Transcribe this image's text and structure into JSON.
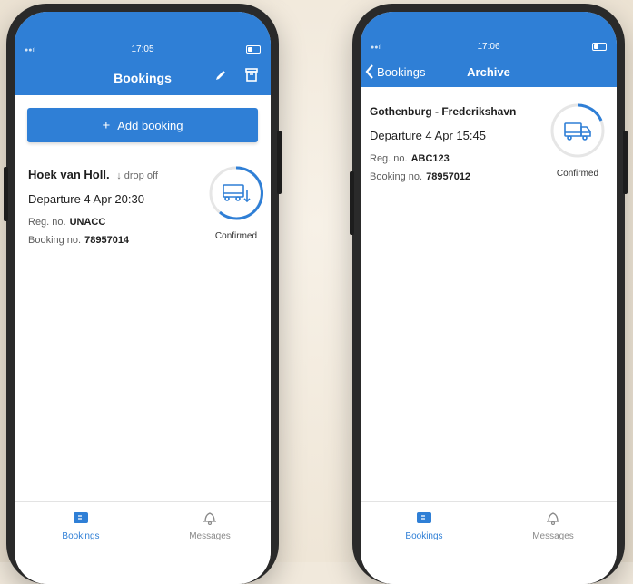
{
  "left": {
    "time": "17:05",
    "title": "Bookings",
    "add_button_label": "Add booking",
    "booking": {
      "route": "Hoek van Holl.",
      "tag": "drop off",
      "departure": "Departure 4 Apr 20:30",
      "reg_label": "Reg. no.",
      "reg_value": "UNACC",
      "booking_label": "Booking no.",
      "booking_value": "78957014",
      "status": "Confirmed",
      "icon": "truck-drop-off-icon"
    },
    "tabs": [
      {
        "label": "Bookings",
        "icon": "ticket-icon",
        "active": true
      },
      {
        "label": "Messages",
        "icon": "bell-icon",
        "active": false
      }
    ]
  },
  "right": {
    "time": "17:06",
    "back_label": "Bookings",
    "title": "Archive",
    "booking": {
      "route": "Gothenburg - Frederikshavn",
      "departure": "Departure 4 Apr 15:45",
      "reg_label": "Reg. no.",
      "reg_value": "ABC123",
      "booking_label": "Booking no.",
      "booking_value": "78957012",
      "status": "Confirmed",
      "icon": "truck-icon"
    },
    "tabs": [
      {
        "label": "Bookings",
        "icon": "ticket-icon",
        "active": true
      },
      {
        "label": "Messages",
        "icon": "bell-icon",
        "active": false
      }
    ]
  },
  "colors": {
    "accent": "#2f7fd6",
    "background": "#f1e9dc"
  }
}
